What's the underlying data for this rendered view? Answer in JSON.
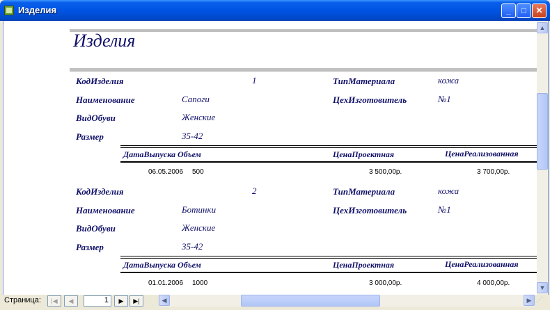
{
  "window": {
    "title": "Изделия"
  },
  "report": {
    "title": "Изделия",
    "labels": {
      "code": "КодИзделия",
      "name": "Наименование",
      "type": "ВидОбуви",
      "size": "Размер",
      "material": "ТипМатериала",
      "workshop": "ЦехИзготовитель"
    },
    "detail_headers": {
      "date_volume": "ДатаВыпуска Объем",
      "price_plan": "ЦенаПроектная",
      "price_real": "ЦенаРеализованная"
    },
    "records": [
      {
        "code": "1",
        "name": "Сапоги",
        "type": "Женские",
        "size": "35-42",
        "material": "кожа",
        "workshop": "№1",
        "date": "06.05.2006",
        "volume": "500",
        "price_plan": "3 500,00р.",
        "price_real": "3 700,00р."
      },
      {
        "code": "2",
        "name": "Ботинки",
        "type": "Женские",
        "size": "35-42",
        "material": "кожа",
        "workshop": "№1",
        "date": "01.01.2006",
        "volume": "1000",
        "price_plan": "3 000,00р.",
        "price_real": "4 000,00р."
      }
    ]
  },
  "navigation": {
    "page_label": "Страница:",
    "page_number": "1"
  },
  "icons": {
    "first": "first-page-icon",
    "prev": "prev-page-icon",
    "next": "next-page-icon",
    "last": "last-page-icon"
  },
  "colors": {
    "title_bar": "#0054e3",
    "report_text": "#10106a",
    "bar": "#c0c0c0"
  }
}
